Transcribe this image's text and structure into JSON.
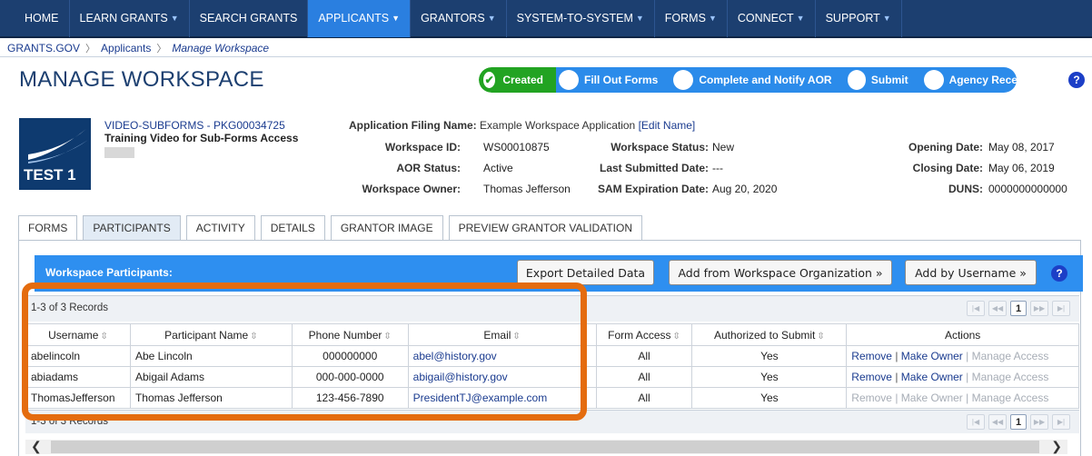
{
  "nav": {
    "items": [
      {
        "label": "HOME",
        "caret": false
      },
      {
        "label": "LEARN GRANTS",
        "caret": true
      },
      {
        "label": "SEARCH GRANTS",
        "caret": false
      },
      {
        "label": "APPLICANTS",
        "caret": true,
        "active": true
      },
      {
        "label": "GRANTORS",
        "caret": true
      },
      {
        "label": "SYSTEM-TO-SYSTEM",
        "caret": true
      },
      {
        "label": "FORMS",
        "caret": true
      },
      {
        "label": "CONNECT",
        "caret": true
      },
      {
        "label": "SUPPORT",
        "caret": true
      }
    ]
  },
  "breadcrumb": {
    "items": [
      "GRANTS.GOV",
      "Applicants",
      "Manage Workspace"
    ]
  },
  "page": {
    "title": "MANAGE WORKSPACE"
  },
  "progress": {
    "steps": [
      "Created",
      "Fill Out Forms",
      "Complete and Notify AOR",
      "Submit",
      "Agency Received"
    ]
  },
  "help_icon": "?",
  "application": {
    "logo_text": "TEST 1",
    "package_link": "VIDEO-SUBFORMS - PKG00034725",
    "package_title": "Training Video for Sub-Forms Access",
    "filing_name_label": "Application Filing Name:",
    "filing_name_value": "Example Workspace Application",
    "edit_name_link": "[Edit Name]",
    "workspace_id_label": "Workspace ID:",
    "workspace_id_value": "WS00010875",
    "aor_status_label": "AOR Status:",
    "aor_status_value": "Active",
    "workspace_owner_label": "Workspace Owner:",
    "workspace_owner_value": "Thomas Jefferson",
    "workspace_status_label": "Workspace Status:",
    "workspace_status_value": "New",
    "last_submitted_label": "Last Submitted Date:",
    "last_submitted_value": "---",
    "sam_expiration_label": "SAM Expiration Date:",
    "sam_expiration_value": "Aug 20, 2020",
    "opening_date_label": "Opening Date:",
    "opening_date_value": "May 08, 2017",
    "closing_date_label": "Closing Date:",
    "closing_date_value": "May 06, 2019",
    "duns_label": "DUNS:",
    "duns_value": "0000000000000"
  },
  "tabs": [
    "FORMS",
    "PARTICIPANTS",
    "ACTIVITY",
    "DETAILS",
    "GRANTOR IMAGE",
    "PREVIEW GRANTOR VALIDATION"
  ],
  "participants": {
    "title": "Workspace Participants:",
    "export_button": "Export Detailed Data",
    "add_org_button": "Add from Workspace Organization »",
    "add_username_button": "Add by Username »",
    "records_text": "1-3 of 3 Records",
    "current_page": "1",
    "columns": [
      "Username",
      "Participant Name",
      "Phone Number",
      "Email",
      "Form Access",
      "Authorized to Submit",
      "Actions"
    ],
    "actions": {
      "remove": "Remove",
      "make_owner": "Make Owner",
      "manage_access": "Manage Access",
      "sep": "|"
    },
    "rows": [
      {
        "username": "abelincoln",
        "name": "Abe Lincoln",
        "phone": "000000000",
        "email": "abel@history.gov",
        "form_access": "All",
        "authorized": "Yes"
      },
      {
        "username": "abiadams",
        "name": "Abigail Adams",
        "phone": "000-000-0000",
        "email": "abigail@history.gov",
        "form_access": "All",
        "authorized": "Yes"
      },
      {
        "username": "ThomasJefferson",
        "name": "Thomas Jefferson",
        "phone": "123-456-7890",
        "email": "PresidentTJ@example.com",
        "form_access": "All",
        "authorized": "Yes"
      }
    ]
  },
  "colors": {
    "nav_bg": "#1c3f70",
    "accent": "#2e8ff0",
    "highlight": "#e46c0f",
    "done": "#22a322"
  }
}
